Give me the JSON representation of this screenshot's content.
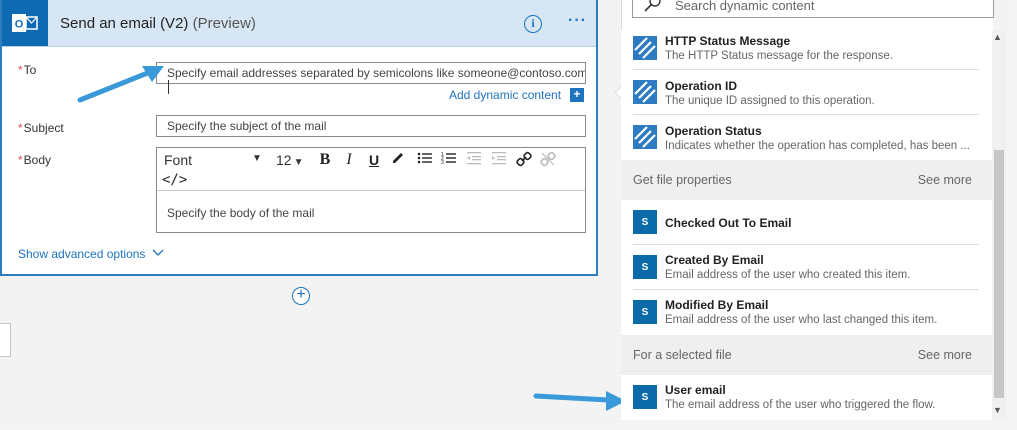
{
  "action": {
    "title": "Send an email (V2)",
    "preview": "(Preview)",
    "info_icon": "info-icon",
    "more_icon": "more-icon"
  },
  "fields": {
    "to": {
      "label": "To",
      "placeholder": "Specify email addresses separated by semicolons like someone@contoso.com"
    },
    "add_dynamic": "Add dynamic content",
    "subject": {
      "label": "Subject",
      "placeholder": "Specify the subject of the mail"
    },
    "body": {
      "label": "Body",
      "font": "Font",
      "size": "12",
      "placeholder": "Specify the body of the mail"
    },
    "required_marker": "*"
  },
  "show_advanced": "Show advanced options",
  "dynamic_panel": {
    "search_placeholder": "Search dynamic content",
    "items_top": [
      {
        "title": "HTTP Status Message",
        "desc": "The HTTP Status message for the response."
      },
      {
        "title": "Operation ID",
        "desc": "The unique ID assigned to this operation."
      },
      {
        "title": "Operation Status",
        "desc": "Indicates whether the operation has completed, has been ..."
      }
    ],
    "section_file_props": {
      "title": "Get file properties",
      "see_more": "See more"
    },
    "items_file": [
      {
        "title": "Checked Out To Email",
        "desc": ""
      },
      {
        "title": "Created By Email",
        "desc": "Email address of the user who created this item."
      },
      {
        "title": "Modified By Email",
        "desc": "Email address of the user who last changed this item."
      }
    ],
    "section_selected": {
      "title": "For a selected file",
      "see_more": "See more"
    },
    "items_selected": [
      {
        "title": "User email",
        "desc": "The email address of the user who triggered the flow."
      }
    ]
  },
  "colors": {
    "accent": "#1e73be",
    "header_bg": "#d6e6f4",
    "arrow": "#3a9ad9"
  }
}
